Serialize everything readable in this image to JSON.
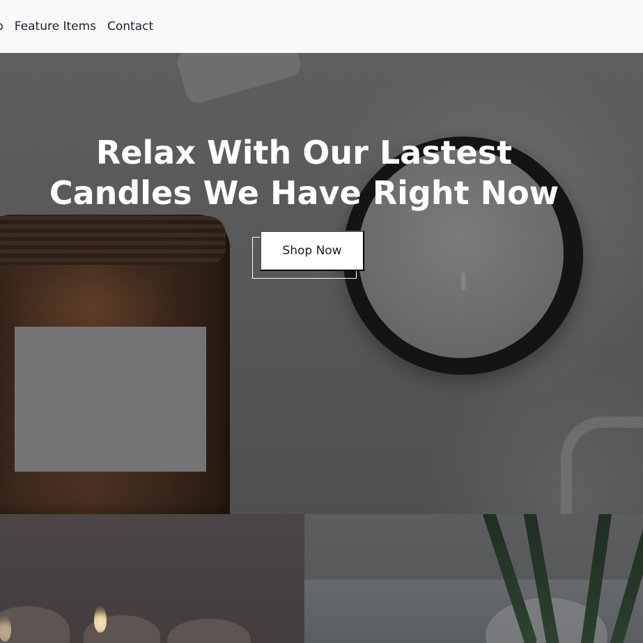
{
  "navbar": {
    "items": [
      {
        "label": "p"
      },
      {
        "label": "Feature Items"
      },
      {
        "label": "Contact"
      }
    ]
  },
  "hero": {
    "title_line1": "Relax With Our Lastest",
    "title_line2": "Candles We Have Right Now",
    "button_label": "Shop Now"
  },
  "colors": {
    "nav_background": "#f8f9fb",
    "nav_text": "#1d1f25",
    "hero_overlay": "#58585a",
    "button_background": "#ffffff",
    "button_text": "#1c1d22",
    "title_text": "#ffffff"
  },
  "icons": {
    "decorative": [
      "candle-jar-image",
      "candle-tin-image",
      "flower-vase-image"
    ]
  }
}
